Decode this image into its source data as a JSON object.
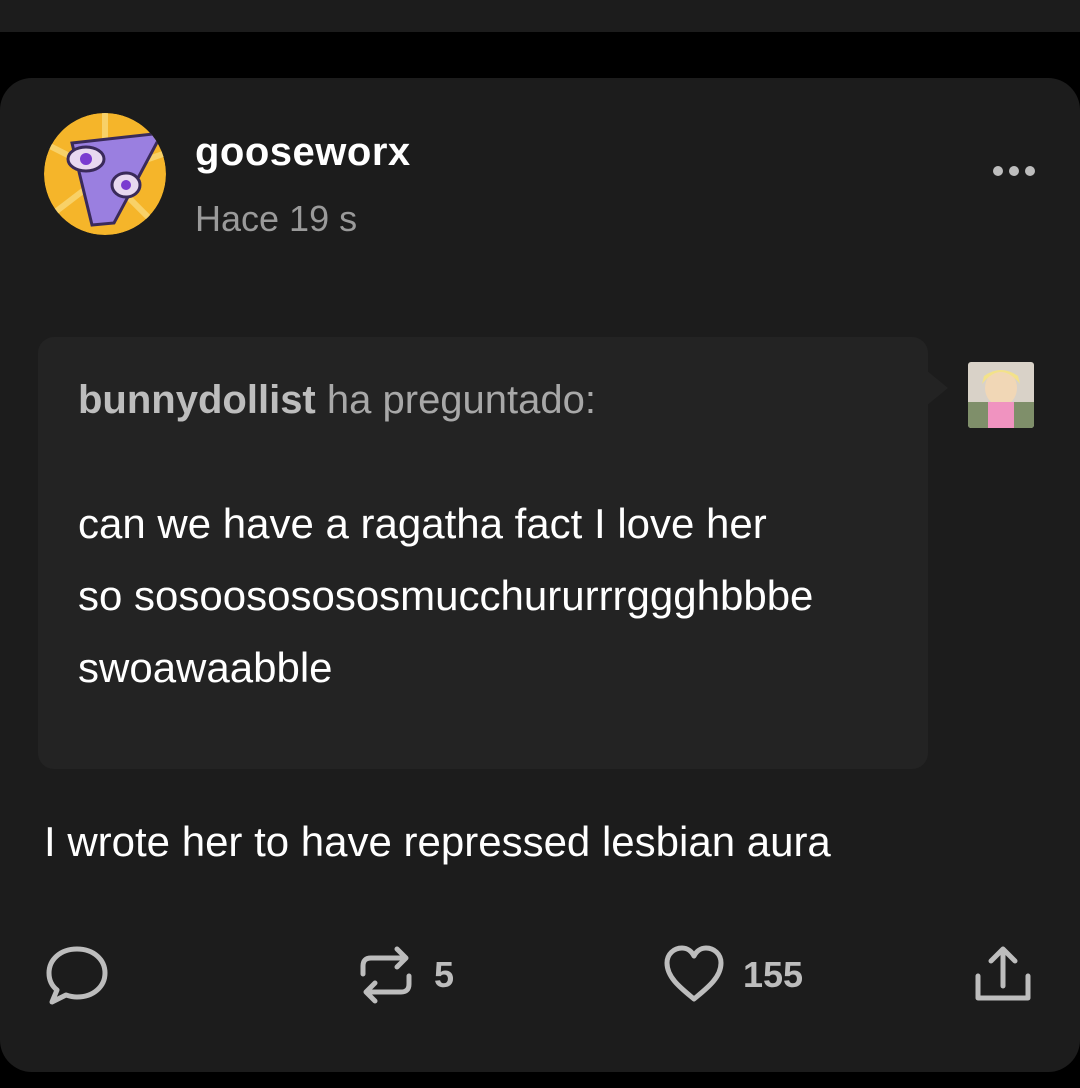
{
  "post": {
    "author": "gooseworx",
    "timestamp": "Hace 19 s",
    "ask": {
      "asker": "bunnydollist",
      "asked_suffix": "ha preguntado:",
      "question_lines": [
        "can we have a ragatha fact I love her",
        "so sosoososososmucchururrrggghbbbe",
        "swoawaabble"
      ]
    },
    "answer": "I wrote her to have repressed lesbian aura",
    "actions": {
      "reblog_count": "5",
      "like_count": "155"
    }
  },
  "colors": {
    "background": "#000000",
    "card": "#1c1c1c",
    "ask_box": "#232323",
    "text_primary": "#ffffff",
    "text_muted": "#9a9a9a"
  },
  "icons": [
    "more-icon",
    "comment-icon",
    "reblog-icon",
    "heart-icon",
    "share-icon"
  ]
}
